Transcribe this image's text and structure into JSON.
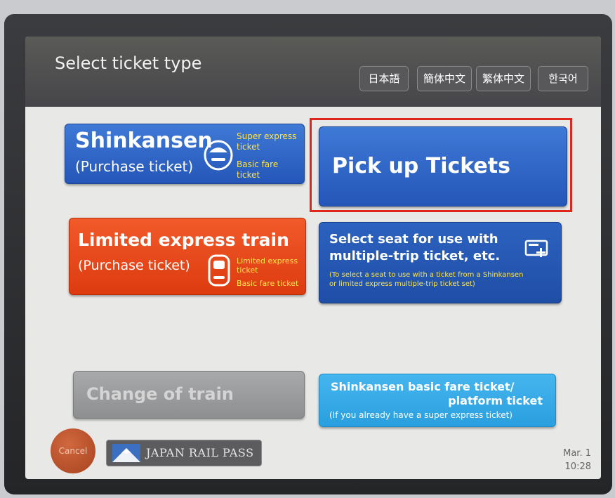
{
  "header": {
    "title": "Select ticket type",
    "languages": [
      "日本語",
      "簡体中文",
      "繁体中文",
      "한국어"
    ]
  },
  "buttons": {
    "shinkansen": {
      "title": "Shinkansen",
      "subtitle": "(Purchase ticket)",
      "note1": "Super express ticket",
      "note2": "Basic fare ticket",
      "icon": "shinkansen-train-icon",
      "color": "#2f66c9"
    },
    "pickup": {
      "title": "Pick up Tickets",
      "color": "#2f66c9"
    },
    "limited_express": {
      "title": "Limited express train",
      "subtitle": "(Purchase ticket)",
      "note1": "Limited express ticket",
      "note2": "Basic fare ticket",
      "icon": "limited-express-train-icon",
      "color": "#e84a1b"
    },
    "select_seat": {
      "title_line1": "Select seat for use with",
      "title_line2": "multiple-trip ticket, etc.",
      "note_line1": "(To select a seat to use with a ticket from a Shinkansen",
      "note_line2": "or limited express multiple-trip ticket set)",
      "icon": "ticket-plus-icon",
      "color": "#2458b5"
    },
    "change_train": {
      "title": "Change of train",
      "color": "#9a9b9d"
    },
    "basic_fare": {
      "title_line1": "Shinkansen basic fare ticket/",
      "title_line2": "platform ticket",
      "note": "(If you already have a super express ticket)",
      "color": "#34a9e8"
    }
  },
  "footer": {
    "cancel_label": "Cancel",
    "jr_pass_label": "JAPAN RAIL PASS",
    "jr_pass_icon": "mount-fuji-icon",
    "date": "Mar. 1",
    "time": "10:28"
  },
  "highlight_color": "#e0251c"
}
